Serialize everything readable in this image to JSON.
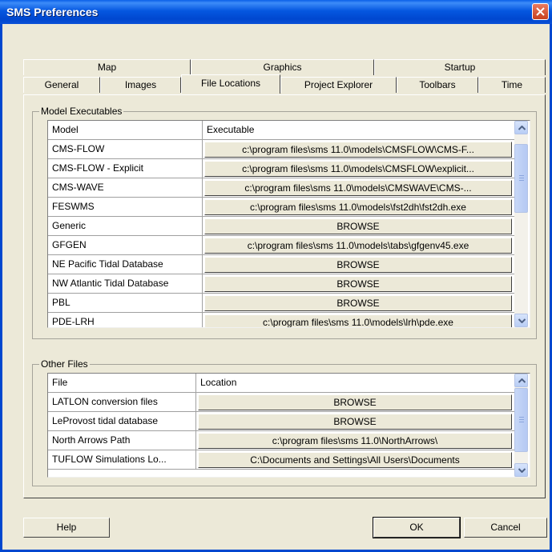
{
  "window": {
    "title": "SMS Preferences"
  },
  "tabs": {
    "row_back": [
      "Map",
      "Graphics",
      "Startup"
    ],
    "row_front": [
      "General",
      "Images",
      "File Locations",
      "Project Explorer",
      "Toolbars",
      "Time"
    ],
    "selected": "File Locations"
  },
  "model_executables": {
    "group_label": "Model Executables",
    "headers": {
      "col1": "Model",
      "col2": "Executable"
    },
    "rows": [
      {
        "model": "CMS-FLOW",
        "executable": "c:\\program files\\sms 11.0\\models\\CMSFLOW\\CMS-F..."
      },
      {
        "model": "CMS-FLOW - Explicit",
        "executable": "c:\\program files\\sms 11.0\\models\\CMSFLOW\\explicit..."
      },
      {
        "model": "CMS-WAVE",
        "executable": "c:\\program files\\sms 11.0\\models\\CMSWAVE\\CMS-..."
      },
      {
        "model": "FESWMS",
        "executable": "c:\\program files\\sms 11.0\\models\\fst2dh\\fst2dh.exe"
      },
      {
        "model": "Generic",
        "executable": "BROWSE"
      },
      {
        "model": "GFGEN",
        "executable": "c:\\program files\\sms 11.0\\models\\tabs\\gfgenv45.exe"
      },
      {
        "model": "NE Pacific Tidal Database",
        "executable": "BROWSE"
      },
      {
        "model": "NW Atlantic Tidal Database",
        "executable": "BROWSE"
      },
      {
        "model": "PBL",
        "executable": "BROWSE"
      },
      {
        "model": "PDE-LRH",
        "executable": "c:\\program files\\sms 11.0\\models\\lrh\\pde.exe"
      }
    ]
  },
  "other_files": {
    "group_label": "Other Files",
    "headers": {
      "col1": "File",
      "col2": "Location"
    },
    "rows": [
      {
        "file": "LATLON conversion files",
        "location": "BROWSE"
      },
      {
        "file": "LeProvost tidal database",
        "location": "BROWSE"
      },
      {
        "file": "North Arrows Path",
        "location": "c:\\program files\\sms 11.0\\NorthArrows\\"
      },
      {
        "file": "TUFLOW Simulations Lo...",
        "location": "C:\\Documents and Settings\\All Users\\Documents"
      }
    ]
  },
  "buttons": {
    "help": "Help",
    "ok": "OK",
    "cancel": "Cancel"
  },
  "colors": {
    "titlebar": "#0054e3",
    "dialog": "#ece9d8",
    "close": "#d9532c"
  }
}
